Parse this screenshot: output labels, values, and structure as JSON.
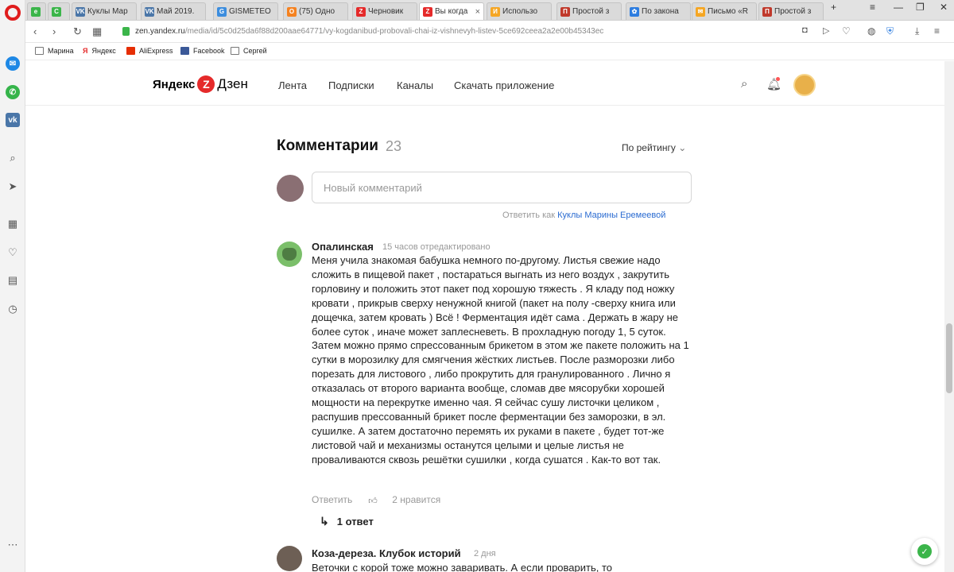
{
  "tabs": [
    {
      "label": "Куклы Мар",
      "icon": "vk-icon",
      "color": "#4a76a8",
      "glyph": "VK"
    },
    {
      "label": "Май 2019.",
      "icon": "vk-icon",
      "color": "#4a76a8",
      "glyph": "VK"
    },
    {
      "label": "GISMETEO",
      "icon": "gismeteo-icon",
      "color": "#3c8dde",
      "glyph": "G"
    },
    {
      "label": "(75) Одно",
      "icon": "odnoklassniki-icon",
      "color": "#f58220",
      "glyph": "О"
    },
    {
      "label": "Черновик",
      "icon": "zen-icon",
      "color": "#e52a2a",
      "glyph": "Z"
    },
    {
      "label": "Вы когда",
      "icon": "zen-icon",
      "color": "#e52a2a",
      "glyph": "Z"
    },
    {
      "label": "Использо",
      "icon": "site-icon",
      "color": "#f5a623",
      "glyph": "И"
    },
    {
      "label": "Простой з",
      "icon": "site-icon",
      "color": "#c0392b",
      "glyph": "П"
    },
    {
      "label": "По закона",
      "icon": "site-icon",
      "color": "#2d7de0",
      "glyph": "✿"
    },
    {
      "label": "Письмо «R",
      "icon": "mail-icon",
      "color": "#f5a623",
      "glyph": "✉"
    },
    {
      "label": "Простой з",
      "icon": "site-icon",
      "color": "#c0392b",
      "glyph": "П"
    }
  ],
  "address": {
    "domain": "zen.yandex.ru",
    "path": "/media/id/5c0d25da6f88d200aae64771/vy-kogdanibud-probovali-chai-iz-vishnevyh-listev-5ce692ceea2a2e00b45343ec"
  },
  "bookmarks": [
    "Марина",
    "Яндекс",
    "AliExpress",
    "Facebook",
    "Сергей"
  ],
  "zen": {
    "logo_text_1": "Яндекс",
    "logo_text_2": "Дзен",
    "nav": [
      "Лента",
      "Подписки",
      "Каналы",
      "Скачать приложение"
    ]
  },
  "comments": {
    "title": "Комментарии",
    "count": "23",
    "sort_label": "По рейтингу",
    "input_placeholder": "Новый комментарий",
    "reply_as_prefix": "Ответить как",
    "reply_as_name": "Куклы Марины Еремеевой",
    "items": [
      {
        "author": "Опалинская",
        "meta": "15 часов  отредактировано",
        "text": "Меня учила знакомая бабушка немного по-другому. Листья свежие надо сложить в пищевой пакет , постараться выгнать из него воздух , закрутить горловину и положить этот пакет под хорошую тяжесть . Я кладу под ножку кровати , прикрыв сверху ненужной книгой (пакет на полу -сверху книга или дощечка, затем кровать ) Всё ! Ферментация идёт сама . Держать в жару не более суток , иначе может заплесневеть. В прохладную погоду 1, 5 суток. Затем можно прямо спрессованным брикетом в этом же пакете положить на 1 сутки в морозилку для смягчения жёстких листьев. После разморозки либо порезать для листового , либо прокрутить для гранулированного . Лично я отказалась от второго варианта вообще, сломав две мясорубки хорошей мощности на перекрутке именно чая. Я сейчас сушу листочки целиком , распушив прессованный брикет после ферментации без заморозки, в эл. сушилке. А затем достаточно перемять их руками в пакете , будет тот-же листовой чай и механизмы останутся целыми и целые листья не проваливаются сквозь решётки сушилки , когда сушатся . Как-то вот так.",
        "reply_label": "Ответить",
        "likes": "2 нравится",
        "replies": "1 ответ"
      },
      {
        "author": "Коза-дереза. Клубок историй",
        "meta": "2 дня",
        "text": "Веточки с корой тоже можно заваривать. А если проварить, то"
      }
    ]
  }
}
